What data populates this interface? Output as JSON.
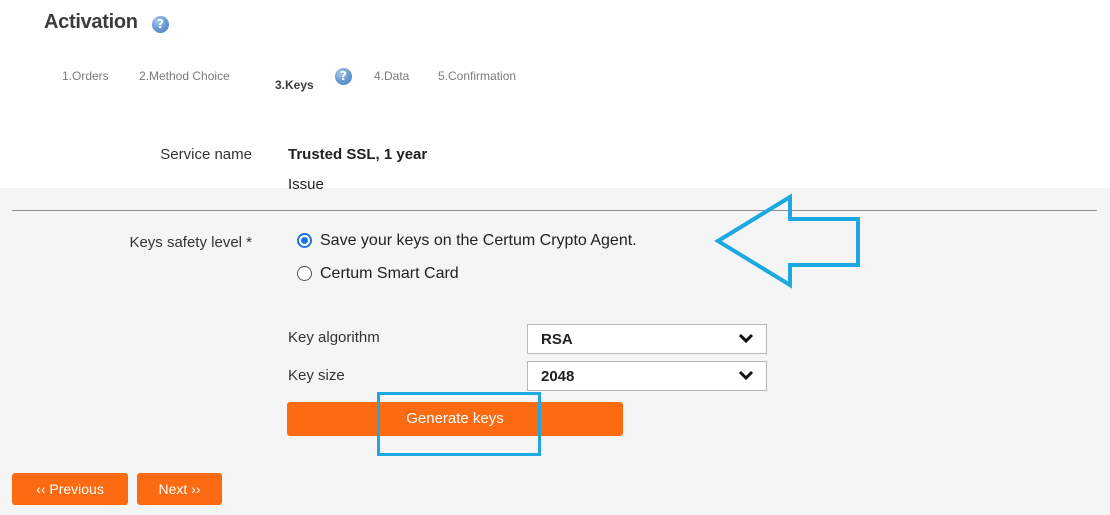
{
  "page": {
    "title": "Activation",
    "help_icon": "?"
  },
  "steps": [
    {
      "label": "1.Orders"
    },
    {
      "label": "2.Method Choice"
    },
    {
      "label": "3.Keys",
      "active": true
    },
    {
      "label": "4.Data"
    },
    {
      "label": "5.Confirmation"
    }
  ],
  "service": {
    "label": "Service name",
    "value": "Trusted SSL, 1 year",
    "sub": "Issue"
  },
  "safety": {
    "label": "Keys safety level *",
    "options": [
      {
        "label": "Save your keys on the Certum Crypto Agent.",
        "checked": true
      },
      {
        "label": "Certum Smart Card",
        "checked": false
      }
    ]
  },
  "keys": {
    "algorithm_label": "Key algorithm",
    "algorithm_value": "RSA",
    "size_label": "Key size",
    "size_value": "2048"
  },
  "buttons": {
    "generate": "Generate keys",
    "previous": "‹‹ Previous",
    "next": "Next ››"
  },
  "colors": {
    "orange": "#fc6a12",
    "annotation_blue": "#1ca8e0",
    "radio_blue": "#1a73e8"
  },
  "icons": {
    "help": "question-circle-icon",
    "chevron": "chevron-down-icon",
    "annotation": "left-arrow-annotation"
  }
}
